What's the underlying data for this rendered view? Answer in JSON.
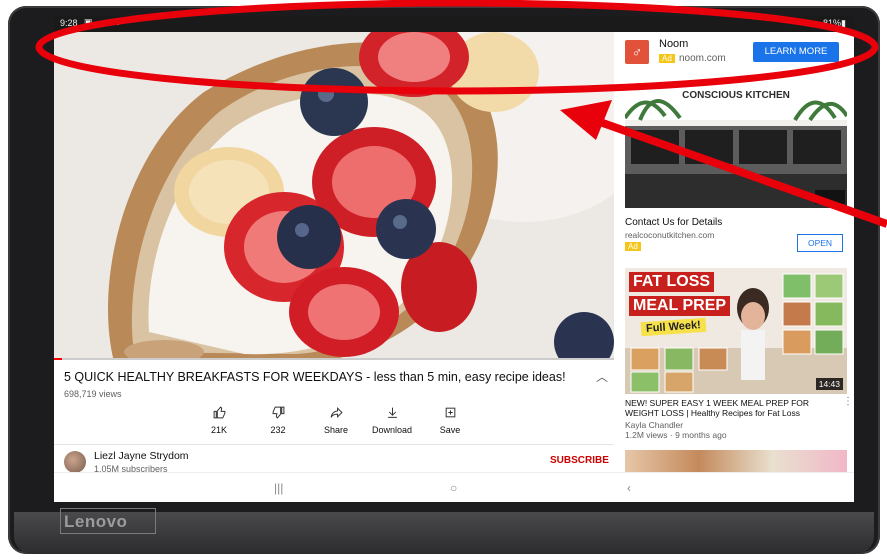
{
  "device": {
    "brand": "Lenovo"
  },
  "status_bar": {
    "time": "9:28",
    "icons": "▣ ☁ ✲ •",
    "battery": "81%"
  },
  "video": {
    "title": "5 QUICK HEALTHY BREAKFASTS FOR WEEKDAYS - less than 5 min, easy recipe ideas!",
    "views": "698,719 views",
    "expand_icon": "chevron-up-icon",
    "actions": [
      {
        "icon": "thumbs-up-icon",
        "label": "21K"
      },
      {
        "icon": "thumbs-down-icon",
        "label": "232"
      },
      {
        "icon": "share-icon",
        "label": "Share"
      },
      {
        "icon": "download-icon",
        "label": "Download"
      },
      {
        "icon": "save-icon",
        "label": "Save"
      }
    ],
    "progress_fraction": 0.014
  },
  "channel": {
    "name": "Liezl Jayne Strydom",
    "subscribers": "1.05M subscribers",
    "subscribe_label": "SUBSCRIBE"
  },
  "sidebar": {
    "ad1": {
      "name": "Noom",
      "ad_badge": "Ad",
      "url": "noom.com",
      "cta": "LEARN MORE"
    },
    "ad2": {
      "image_heading": "CONSCIOUS KITCHEN",
      "title": "Contact Us for Details",
      "url": "realcoconutkitchen.com",
      "ad_badge": "Ad",
      "cta": "OPEN"
    },
    "video2": {
      "thumb_line1": "FAT LOSS",
      "thumb_line2": "MEAL PREP",
      "thumb_line3": "Full Week!",
      "duration": "14:43",
      "title": "NEW!  SUPER EASY 1 WEEK MEAL PREP FOR WEIGHT LOSS | Healthy Recipes for Fat Loss",
      "channel": "Kayla Chandler",
      "meta": "1.2M views · 9 months ago"
    }
  },
  "nav": {
    "recents": "|||",
    "home": "○",
    "back": "‹"
  },
  "colors": {
    "accent_red": "#ff0000",
    "annotation_red": "#e8000b",
    "link_blue": "#1a73e8"
  }
}
